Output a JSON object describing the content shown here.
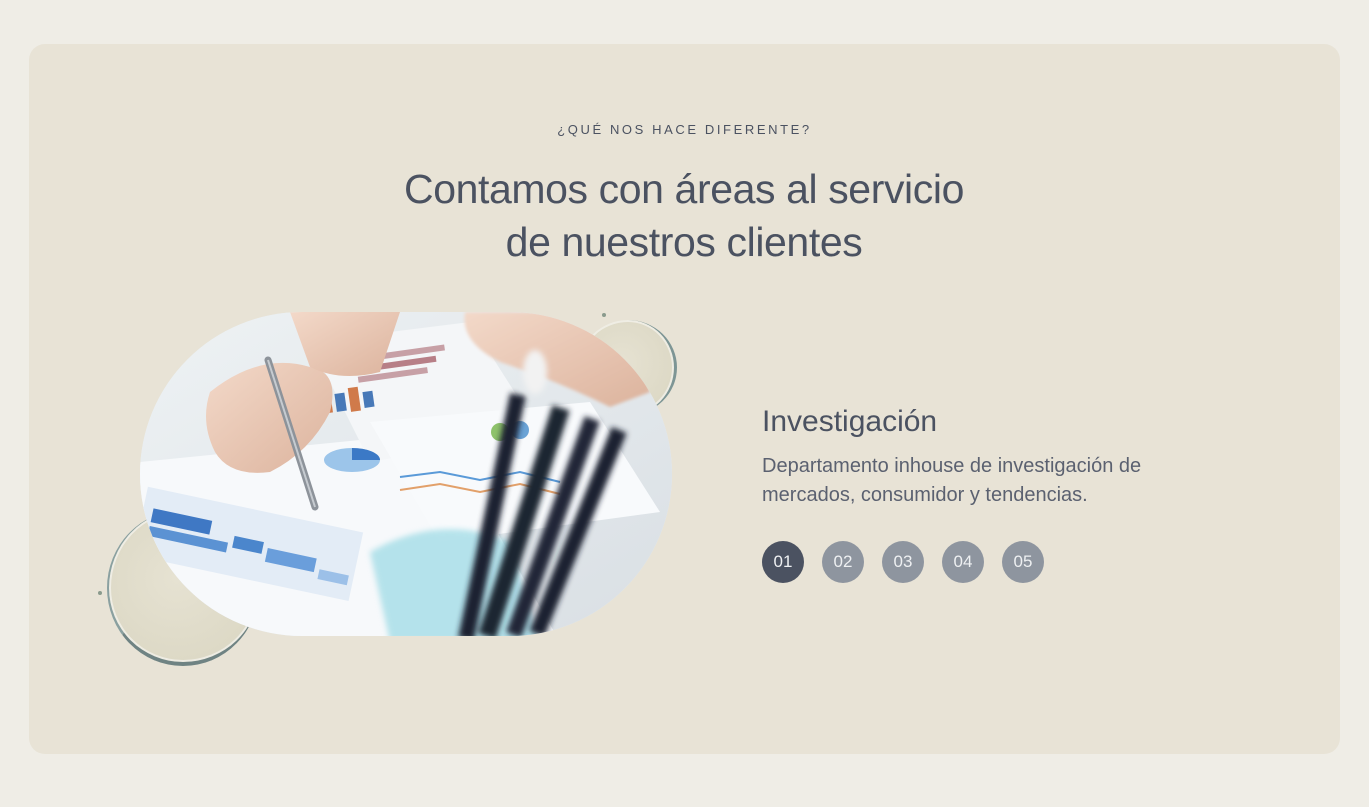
{
  "section": {
    "eyebrow": "¿QUÉ NOS HACE DIFERENTE?",
    "headline_line1": "Contamos con áreas al servicio",
    "headline_line2": "de nuestros clientes"
  },
  "feature": {
    "title": "Investigación",
    "description": "Departamento inhouse de investigación de mercados, consumidor y tendencias.",
    "image_alt": "business-analysis-photo"
  },
  "pager": {
    "items": [
      "01",
      "02",
      "03",
      "04",
      "05"
    ],
    "active_index": 0
  },
  "colors": {
    "page_bg": "#efede6",
    "card_bg": "#e8e3d6",
    "text": "#4b5261",
    "pager_inactive": "#8e959f",
    "pager_active": "#4b5261"
  }
}
